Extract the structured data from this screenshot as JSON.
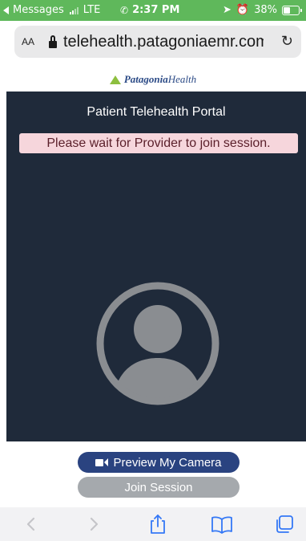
{
  "status_bar": {
    "carrier": "Messages",
    "network": "LTE",
    "time": "2:37 PM",
    "battery": "38%"
  },
  "browser": {
    "reader_label": "AA",
    "url": "telehealth.patagoniaemr.com"
  },
  "brand": {
    "name_bold": "Patagonia",
    "name_rest": "Health",
    "logo_color": "#8dbf3f"
  },
  "portal": {
    "title": "Patient Telehealth Portal",
    "banner": "Please wait for Provider to join session."
  },
  "buttons": {
    "preview": "Preview My Camera",
    "join": "Join Session"
  },
  "toolbar": {
    "icons": [
      "back-icon",
      "forward-icon",
      "share-icon",
      "bookmarks-icon",
      "tabs-icon"
    ]
  },
  "colors": {
    "status_bar": "#5fb85b",
    "video_bg": "#1f2a3a",
    "banner_bg": "#f6d6dc",
    "primary_button": "#2a4380",
    "disabled_button": "#a5a9ad",
    "avatar": "#8a8d91"
  }
}
